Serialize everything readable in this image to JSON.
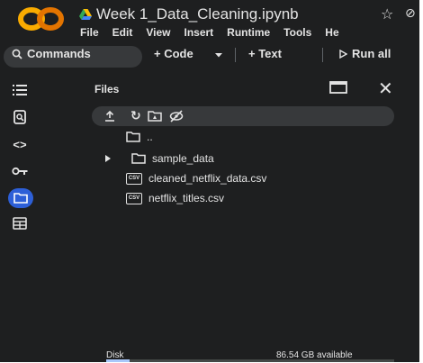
{
  "app": {
    "notebook_title": "Week 1_Data_Cleaning.ipynb",
    "brand_colors": {
      "logo_orange": "#f9ab00",
      "logo_deep": "#e37400",
      "accent_blue": "#2d5fd7"
    }
  },
  "menu": [
    "File",
    "Edit",
    "View",
    "Insert",
    "Runtime",
    "Tools",
    "He"
  ],
  "toolbar": {
    "commands_label": "Commands",
    "code_label": "+ Code",
    "text_label": "+ Text",
    "run_all_label": "Run all"
  },
  "sidebar_icons": [
    "toc-icon",
    "find-icon",
    "code-snippets-icon",
    "secrets-key-icon",
    "folder-icon",
    "terminal-icon"
  ],
  "files_panel": {
    "title": "Files",
    "parent_dir": "..",
    "items": [
      {
        "name": "sample_data",
        "type": "folder",
        "expandable": true
      },
      {
        "name": "cleaned_netflix_data.csv",
        "type": "csv"
      },
      {
        "name": "netflix_titles.csv",
        "type": "csv"
      }
    ],
    "csv_badge": "CSV",
    "disk_label": "Disk",
    "disk_available": "86.54 GB available",
    "disk_used_fraction": 0.08
  }
}
